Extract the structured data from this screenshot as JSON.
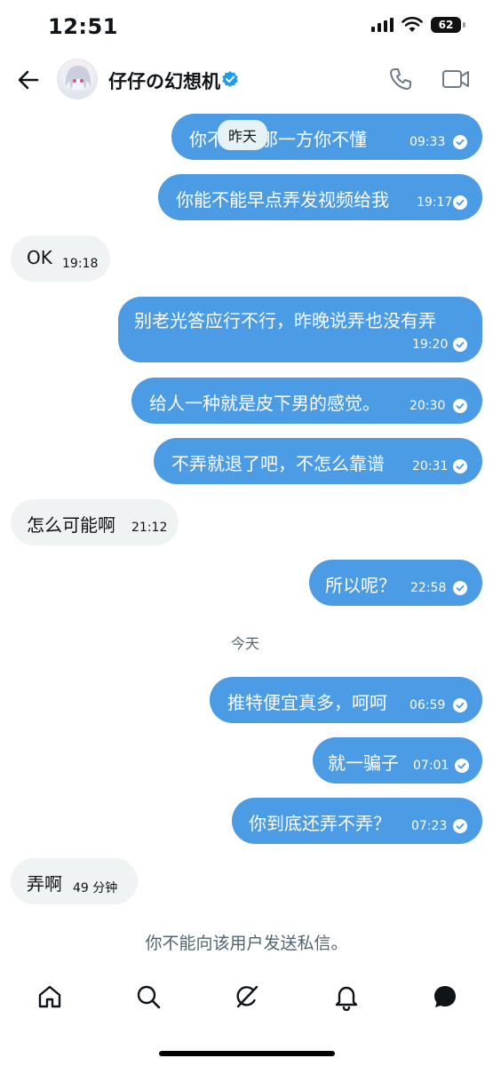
{
  "status_bar": {
    "time": "12:51",
    "battery": "62"
  },
  "header": {
    "contact_name": "仔仔の幻想机"
  },
  "date_labels": {
    "yesterday": "昨天",
    "today": "今天"
  },
  "messages": [
    {
      "direction": "out",
      "text": "你不…待那一方你不懂",
      "time": "09:33"
    },
    {
      "direction": "out",
      "text": "你能不能早点弄发视频给我",
      "time": "19:17"
    },
    {
      "direction": "in",
      "text": "OK",
      "time": "19:18"
    },
    {
      "direction": "out",
      "text": "别老光答应行不行，昨晚说弄也没有弄",
      "time": "19:20"
    },
    {
      "direction": "out",
      "text": "给人一种就是皮下男的感觉。",
      "time": "20:30"
    },
    {
      "direction": "out",
      "text": "不弄就退了吧，不怎么靠谱",
      "time": "20:31"
    },
    {
      "direction": "in",
      "text": "怎么可能啊",
      "time": "21:12"
    },
    {
      "direction": "out",
      "text": "所以呢？",
      "time": "22:58"
    },
    {
      "direction": "out",
      "text": "推特便宜真多，呵呵",
      "time": "06:59"
    },
    {
      "direction": "out",
      "text": "就一骗子",
      "time": "07:01"
    },
    {
      "direction": "out",
      "text": "你到底还弄不弄？",
      "time": "07:23"
    },
    {
      "direction": "in",
      "text": "弄啊",
      "time": "49 分钟"
    }
  ],
  "notice": "你不能向该用户发送私信。",
  "colors": {
    "out_bubble": "#4c9be5",
    "in_bubble": "#eff3f4",
    "verified": "#1d9bf0"
  },
  "icons": {
    "header": [
      "back-arrow-icon",
      "verified-badge-icon",
      "phone-icon",
      "video-icon"
    ],
    "tab_bar": [
      "home-icon",
      "search-icon",
      "grok-icon",
      "bell-icon",
      "messages-icon"
    ]
  }
}
